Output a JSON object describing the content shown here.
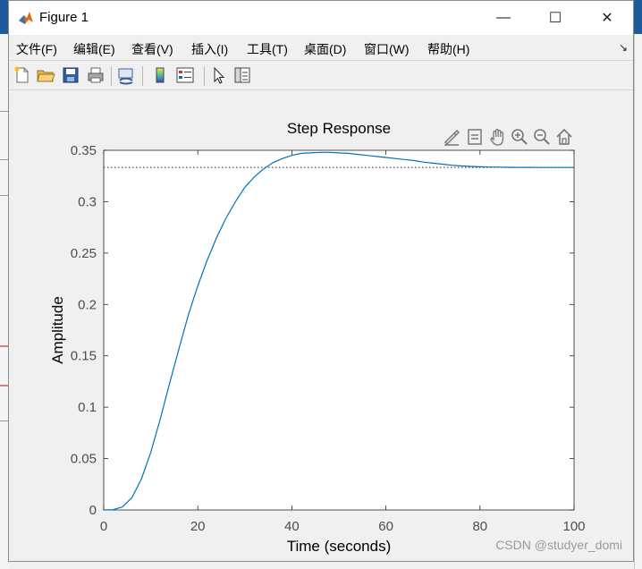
{
  "window": {
    "title": "Figure 1",
    "controls": {
      "minimize": "—",
      "maximize": "☐",
      "close": "✕"
    }
  },
  "menu": [
    "文件(F)",
    "编辑(E)",
    "查看(V)",
    "插入(I)",
    "工具(T)",
    "桌面(D)",
    "窗口(W)",
    "帮助(H)"
  ],
  "menu_dock_glyph": "↘",
  "toolbar": {
    "icons": [
      "new-figure-icon",
      "open-file-icon",
      "save-icon",
      "print-icon",
      "link-plot-icon",
      "insert-colorbar-icon",
      "insert-legend-icon",
      "edit-plot-arrow-icon",
      "property-inspector-icon"
    ]
  },
  "axes_toolbar": {
    "icons": [
      "brush-icon",
      "data-tips-icon",
      "pan-hand-icon",
      "zoom-in-icon",
      "zoom-out-icon",
      "home-restore-icon"
    ]
  },
  "chart_data": {
    "type": "line",
    "title": "Step Response",
    "xlabel": "Time (seconds)",
    "ylabel": "Amplitude",
    "xlim": [
      0,
      100
    ],
    "ylim": [
      0,
      0.35
    ],
    "xticks": [
      0,
      20,
      40,
      60,
      80,
      100
    ],
    "yticks": [
      0,
      0.05,
      0.1,
      0.15,
      0.2,
      0.25,
      0.3,
      0.35
    ],
    "ytick_labels": [
      "0",
      "0.05",
      "0.1",
      "0.15",
      "0.2",
      "0.25",
      "0.3",
      "0.35"
    ],
    "steady_state": 0.3333,
    "series": [
      {
        "color": "#0072bd",
        "x": [
          0,
          2,
          4,
          6,
          8,
          10,
          12,
          14,
          16,
          18,
          20,
          22,
          24,
          26,
          28,
          30,
          32,
          34,
          36,
          38,
          40,
          42,
          44,
          46,
          48,
          50,
          52,
          54,
          56,
          58,
          60,
          62,
          64,
          66,
          68,
          70,
          72,
          74,
          76,
          78,
          80,
          82,
          84,
          86,
          88,
          90,
          92,
          94,
          96,
          98,
          100
        ],
        "y": [
          0,
          0.0003,
          0.003,
          0.012,
          0.03,
          0.056,
          0.088,
          0.123,
          0.157,
          0.19,
          0.218,
          0.243,
          0.265,
          0.284,
          0.3,
          0.314,
          0.324,
          0.332,
          0.338,
          0.342,
          0.345,
          0.347,
          0.3475,
          0.348,
          0.348,
          0.3475,
          0.347,
          0.346,
          0.345,
          0.344,
          0.343,
          0.342,
          0.341,
          0.34,
          0.3385,
          0.3375,
          0.3365,
          0.3355,
          0.3348,
          0.3343,
          0.334,
          0.3337,
          0.3336,
          0.3335,
          0.3334,
          0.3334,
          0.3333,
          0.3333,
          0.3333,
          0.3333,
          0.3333
        ]
      }
    ]
  },
  "watermark": "CSDN @studyer_domi"
}
